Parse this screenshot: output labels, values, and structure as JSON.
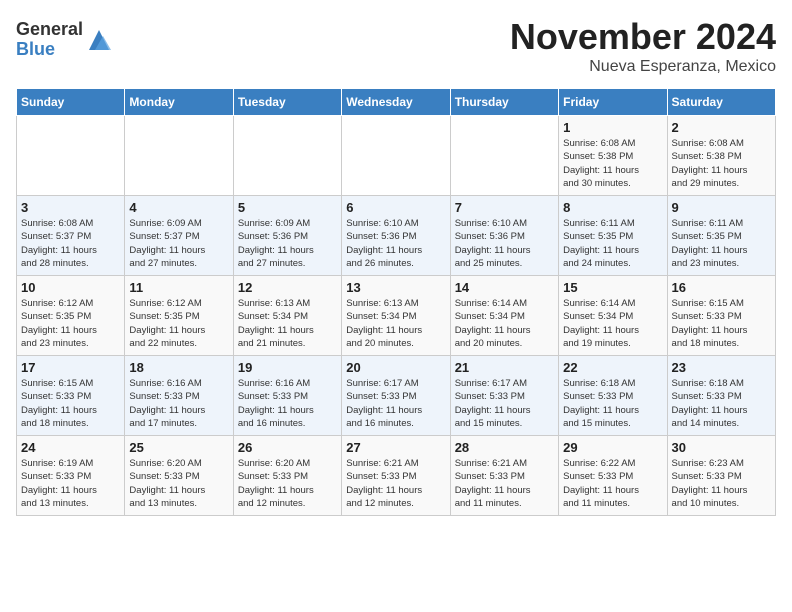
{
  "logo": {
    "general": "General",
    "blue": "Blue"
  },
  "title": "November 2024",
  "subtitle": "Nueva Esperanza, Mexico",
  "days_of_week": [
    "Sunday",
    "Monday",
    "Tuesday",
    "Wednesday",
    "Thursday",
    "Friday",
    "Saturday"
  ],
  "weeks": [
    [
      {
        "day": "",
        "detail": ""
      },
      {
        "day": "",
        "detail": ""
      },
      {
        "day": "",
        "detail": ""
      },
      {
        "day": "",
        "detail": ""
      },
      {
        "day": "",
        "detail": ""
      },
      {
        "day": "1",
        "detail": "Sunrise: 6:08 AM\nSunset: 5:38 PM\nDaylight: 11 hours\nand 30 minutes."
      },
      {
        "day": "2",
        "detail": "Sunrise: 6:08 AM\nSunset: 5:38 PM\nDaylight: 11 hours\nand 29 minutes."
      }
    ],
    [
      {
        "day": "3",
        "detail": "Sunrise: 6:08 AM\nSunset: 5:37 PM\nDaylight: 11 hours\nand 28 minutes."
      },
      {
        "day": "4",
        "detail": "Sunrise: 6:09 AM\nSunset: 5:37 PM\nDaylight: 11 hours\nand 27 minutes."
      },
      {
        "day": "5",
        "detail": "Sunrise: 6:09 AM\nSunset: 5:36 PM\nDaylight: 11 hours\nand 27 minutes."
      },
      {
        "day": "6",
        "detail": "Sunrise: 6:10 AM\nSunset: 5:36 PM\nDaylight: 11 hours\nand 26 minutes."
      },
      {
        "day": "7",
        "detail": "Sunrise: 6:10 AM\nSunset: 5:36 PM\nDaylight: 11 hours\nand 25 minutes."
      },
      {
        "day": "8",
        "detail": "Sunrise: 6:11 AM\nSunset: 5:35 PM\nDaylight: 11 hours\nand 24 minutes."
      },
      {
        "day": "9",
        "detail": "Sunrise: 6:11 AM\nSunset: 5:35 PM\nDaylight: 11 hours\nand 23 minutes."
      }
    ],
    [
      {
        "day": "10",
        "detail": "Sunrise: 6:12 AM\nSunset: 5:35 PM\nDaylight: 11 hours\nand 23 minutes."
      },
      {
        "day": "11",
        "detail": "Sunrise: 6:12 AM\nSunset: 5:35 PM\nDaylight: 11 hours\nand 22 minutes."
      },
      {
        "day": "12",
        "detail": "Sunrise: 6:13 AM\nSunset: 5:34 PM\nDaylight: 11 hours\nand 21 minutes."
      },
      {
        "day": "13",
        "detail": "Sunrise: 6:13 AM\nSunset: 5:34 PM\nDaylight: 11 hours\nand 20 minutes."
      },
      {
        "day": "14",
        "detail": "Sunrise: 6:14 AM\nSunset: 5:34 PM\nDaylight: 11 hours\nand 20 minutes."
      },
      {
        "day": "15",
        "detail": "Sunrise: 6:14 AM\nSunset: 5:34 PM\nDaylight: 11 hours\nand 19 minutes."
      },
      {
        "day": "16",
        "detail": "Sunrise: 6:15 AM\nSunset: 5:33 PM\nDaylight: 11 hours\nand 18 minutes."
      }
    ],
    [
      {
        "day": "17",
        "detail": "Sunrise: 6:15 AM\nSunset: 5:33 PM\nDaylight: 11 hours\nand 18 minutes."
      },
      {
        "day": "18",
        "detail": "Sunrise: 6:16 AM\nSunset: 5:33 PM\nDaylight: 11 hours\nand 17 minutes."
      },
      {
        "day": "19",
        "detail": "Sunrise: 6:16 AM\nSunset: 5:33 PM\nDaylight: 11 hours\nand 16 minutes."
      },
      {
        "day": "20",
        "detail": "Sunrise: 6:17 AM\nSunset: 5:33 PM\nDaylight: 11 hours\nand 16 minutes."
      },
      {
        "day": "21",
        "detail": "Sunrise: 6:17 AM\nSunset: 5:33 PM\nDaylight: 11 hours\nand 15 minutes."
      },
      {
        "day": "22",
        "detail": "Sunrise: 6:18 AM\nSunset: 5:33 PM\nDaylight: 11 hours\nand 15 minutes."
      },
      {
        "day": "23",
        "detail": "Sunrise: 6:18 AM\nSunset: 5:33 PM\nDaylight: 11 hours\nand 14 minutes."
      }
    ],
    [
      {
        "day": "24",
        "detail": "Sunrise: 6:19 AM\nSunset: 5:33 PM\nDaylight: 11 hours\nand 13 minutes."
      },
      {
        "day": "25",
        "detail": "Sunrise: 6:20 AM\nSunset: 5:33 PM\nDaylight: 11 hours\nand 13 minutes."
      },
      {
        "day": "26",
        "detail": "Sunrise: 6:20 AM\nSunset: 5:33 PM\nDaylight: 11 hours\nand 12 minutes."
      },
      {
        "day": "27",
        "detail": "Sunrise: 6:21 AM\nSunset: 5:33 PM\nDaylight: 11 hours\nand 12 minutes."
      },
      {
        "day": "28",
        "detail": "Sunrise: 6:21 AM\nSunset: 5:33 PM\nDaylight: 11 hours\nand 11 minutes."
      },
      {
        "day": "29",
        "detail": "Sunrise: 6:22 AM\nSunset: 5:33 PM\nDaylight: 11 hours\nand 11 minutes."
      },
      {
        "day": "30",
        "detail": "Sunrise: 6:23 AM\nSunset: 5:33 PM\nDaylight: 11 hours\nand 10 minutes."
      }
    ]
  ]
}
